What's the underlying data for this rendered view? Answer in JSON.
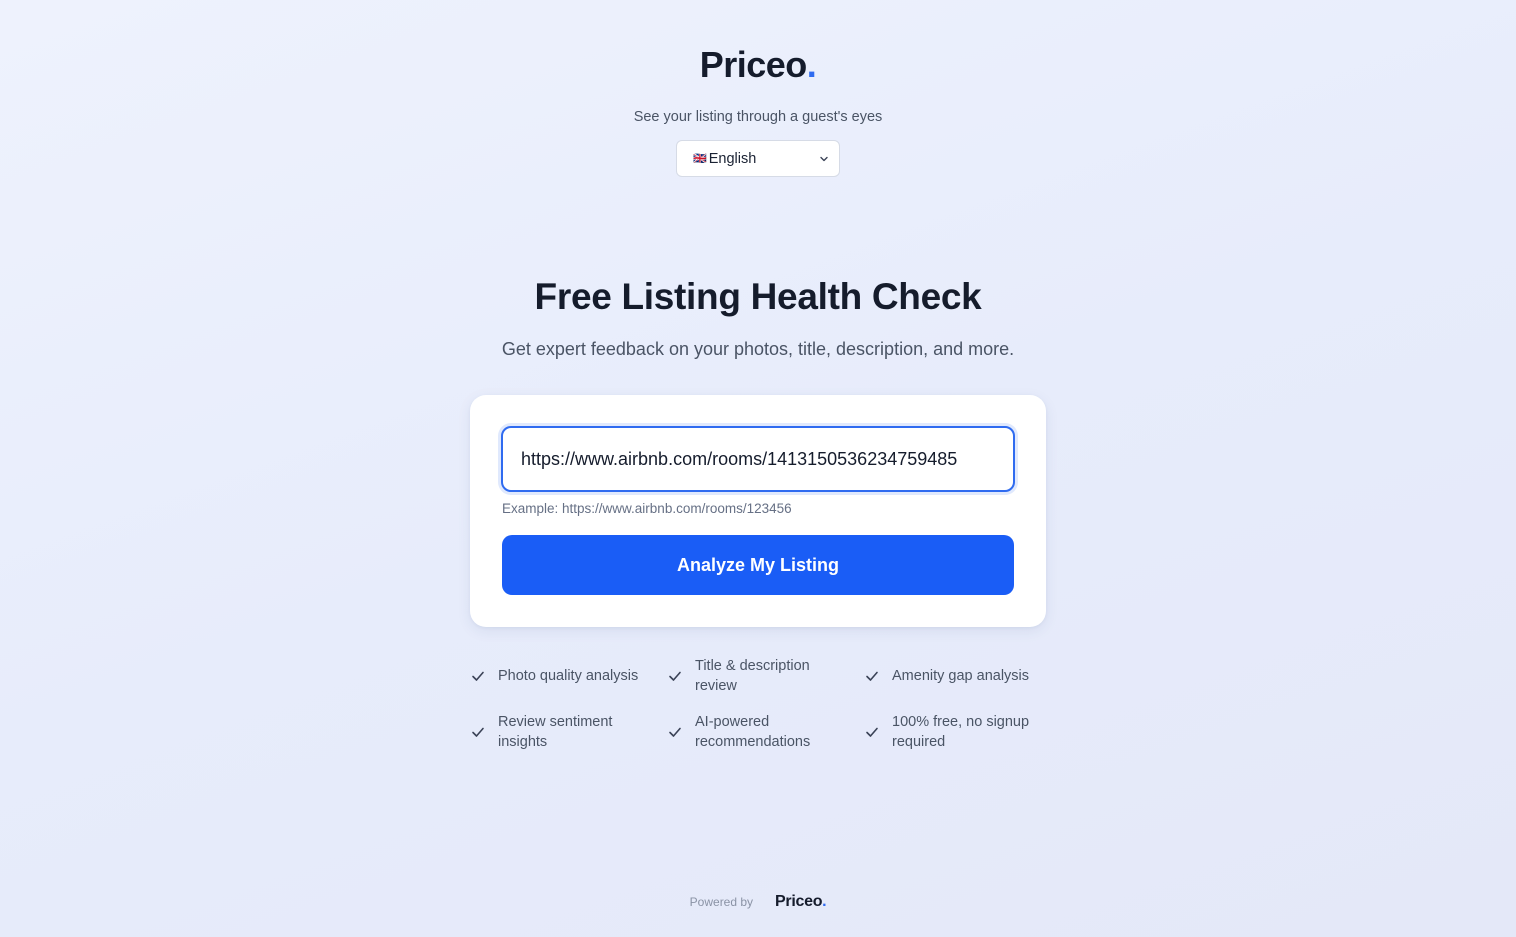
{
  "brand": {
    "name": "Priceo",
    "dot": "."
  },
  "tagline": "See your listing through a guest's eyes",
  "language": {
    "flag": "🇬🇧",
    "selected": "English"
  },
  "hero": {
    "title": "Free Listing Health Check",
    "subtitle": "Get expert feedback on your photos, title, description, and more."
  },
  "form": {
    "url_value": "https://www.airbnb.com/rooms/1413150536234759485",
    "example": "Example: https://www.airbnb.com/rooms/123456",
    "button_label": "Analyze My Listing"
  },
  "features": [
    "Photo quality analysis",
    "Title & description review",
    "Amenity gap analysis",
    "Review sentiment insights",
    "AI-powered recommendations",
    "100% free, no signup required"
  ],
  "footer": {
    "powered_by": "Powered by",
    "brand": "Priceo",
    "dot": "."
  },
  "colors": {
    "accent": "#1a5df6",
    "brand_dot": "#2f6bf0",
    "text_dark": "#151c2c",
    "text_muted": "#4a5465"
  }
}
